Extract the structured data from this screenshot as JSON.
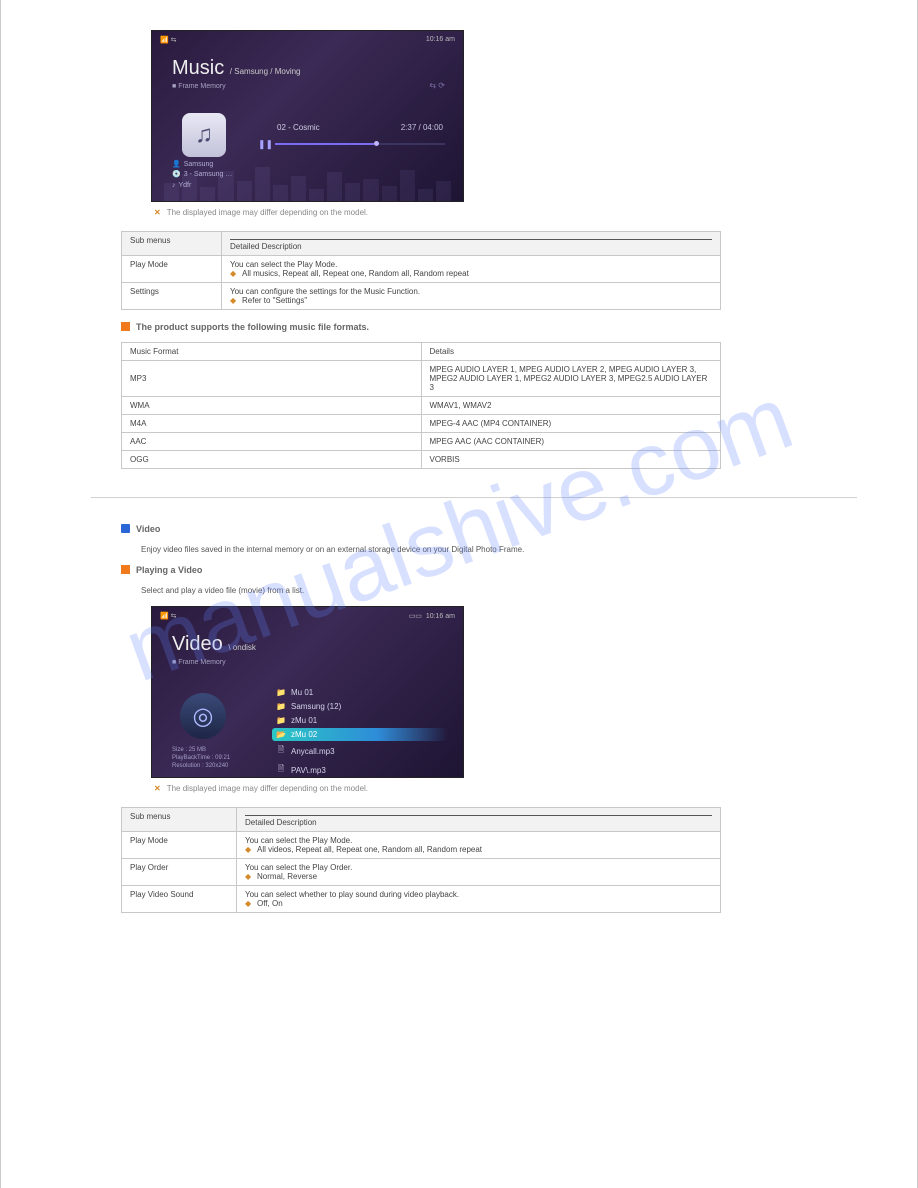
{
  "watermark": "manualshive.com",
  "music_shot": {
    "clock": "10:16 am",
    "title": "Music",
    "path": "/ Samsung / Moving",
    "underline": "Frame Memory",
    "track": "02 - Cosmic",
    "time": "2:37 / 04:00",
    "meta_artist": "Samsung",
    "meta_album": "3 - Samsung …",
    "meta_year": "Ydfr"
  },
  "music_note": "The displayed image may differ depending on the model.",
  "music_menu_header_left": "Sub menus",
  "music_menu_header_right": "Detailed Description",
  "music_menu": {
    "row1_label": "Play Mode",
    "row1_text": "You can select the Play Mode.",
    "row1_bullet": "All musics, Repeat all, Repeat one, Random all, Random repeat",
    "row2_label": "Settings",
    "row2_text": "You can configure the settings for the Music Function.",
    "row2_bullet": "Refer to \"Settings\""
  },
  "music_fmt_head": "The product supports the following music file formats.",
  "music_format_table": {
    "h1": "Music Format",
    "h2": "Details",
    "r1a": "MP3",
    "r1b": "MPEG AUDIO LAYER 1, MPEG AUDIO LAYER 2, MPEG AUDIO LAYER 3, MPEG2 AUDIO LAYER 1, MPEG2 AUDIO LAYER 3, MPEG2.5 AUDIO LAYER 3",
    "r2a": "WMA",
    "r2b": "WMAV1, WMAV2",
    "r3a": "M4A",
    "r3b": "MPEG-4 AAC (MP4 CONTAINER)",
    "r4a": "AAC",
    "r4b": "MPEG AAC (AAC CONTAINER)",
    "r5a": "OGG",
    "r5b": "VORBIS"
  },
  "video_title": "Video",
  "video_intro": "Enjoy video files saved in the internal memory or on an external storage device on your Digital Photo Frame.",
  "video_sub_head": "Playing a Video",
  "video_sub_text": "Select and play a video file (movie) from a list.",
  "video_shot": {
    "clock": "10:16 am",
    "title": "Video",
    "path": "\\ ondisk",
    "underline": "Frame Memory",
    "list": [
      "Mu 01",
      "Samsung (12)",
      "zMu 01",
      "zMu 02",
      "Anycall.mp3",
      "PAV\\.mp3"
    ],
    "sel_index": 3,
    "size": "Size : 25 MB",
    "playback": "PlayBackTime : 09:21",
    "res": "Resolution : 320x240"
  },
  "video_note": "The displayed image may differ depending on the model.",
  "video_menu_header_left": "Sub menus",
  "video_menu_header_right": "Detailed Description",
  "video_menu": {
    "r1_label": "Play Mode",
    "r1_text": "You can select the Play Mode.",
    "r1_bullet": "All videos, Repeat all, Repeat one, Random all, Random repeat",
    "r2_label": "Play Order",
    "r2_text": "You can select the Play Order.",
    "r2_bullet": "Normal, Reverse",
    "r3_label": "Play Video Sound",
    "r3_text": "You can select whether to play sound during video playback.",
    "r3_bullet": "Off, On"
  }
}
